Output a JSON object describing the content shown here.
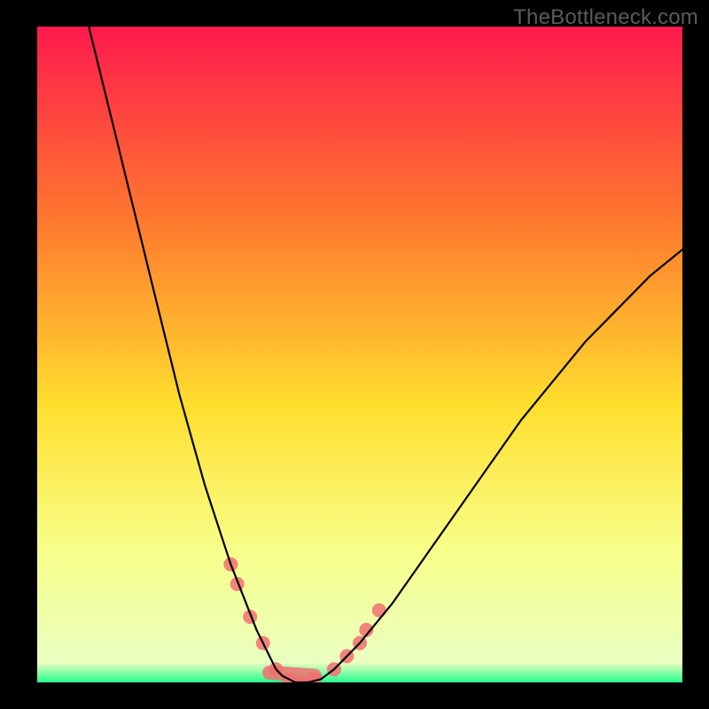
{
  "watermark": "TheBottleneck.com",
  "colors": {
    "background": "#000000",
    "gradient_top": "#ff1a4d",
    "gradient_mid_upper": "#ff7a2e",
    "gradient_mid": "#ffdf2e",
    "gradient_lower": "#f7ff8a",
    "gradient_bottom": "#26ff8f",
    "curve": "#000000",
    "marker": "#f07070"
  },
  "chart_data": {
    "type": "line",
    "title": "",
    "xlabel": "",
    "ylabel": "",
    "xlim": [
      0,
      100
    ],
    "ylim": [
      0,
      100
    ],
    "grid": false,
    "legend": false,
    "series": [
      {
        "name": "bottleneck-curve",
        "x": [
          8,
          10,
          12,
          14,
          16,
          18,
          20,
          22,
          24,
          26,
          28,
          30,
          32,
          34,
          35,
          36,
          37,
          38,
          39,
          40,
          42,
          44,
          46,
          50,
          55,
          60,
          65,
          70,
          75,
          80,
          85,
          90,
          95,
          100
        ],
        "y": [
          100,
          92,
          84,
          76,
          68,
          60,
          52,
          44,
          37,
          30,
          24,
          18,
          13,
          8,
          6,
          4,
          2,
          1,
          0.5,
          0,
          0,
          0.5,
          2,
          6,
          12,
          19,
          26,
          33,
          40,
          46,
          52,
          57,
          62,
          66
        ]
      }
    ],
    "markers": [
      {
        "x": 30,
        "y": 18
      },
      {
        "x": 31,
        "y": 15
      },
      {
        "x": 33,
        "y": 10
      },
      {
        "x": 35,
        "y": 6
      },
      {
        "x": 37,
        "y": 2
      },
      {
        "x": 39,
        "y": 0.5
      },
      {
        "x": 41,
        "y": 0
      },
      {
        "x": 43,
        "y": 0.5
      },
      {
        "x": 46,
        "y": 2
      },
      {
        "x": 48,
        "y": 4
      },
      {
        "x": 50,
        "y": 6
      },
      {
        "x": 51,
        "y": 8
      },
      {
        "x": 53,
        "y": 11
      }
    ],
    "marker_segments": [
      {
        "x0": 36,
        "y0": 1.5,
        "x1": 43,
        "y1": 1.0
      }
    ]
  }
}
